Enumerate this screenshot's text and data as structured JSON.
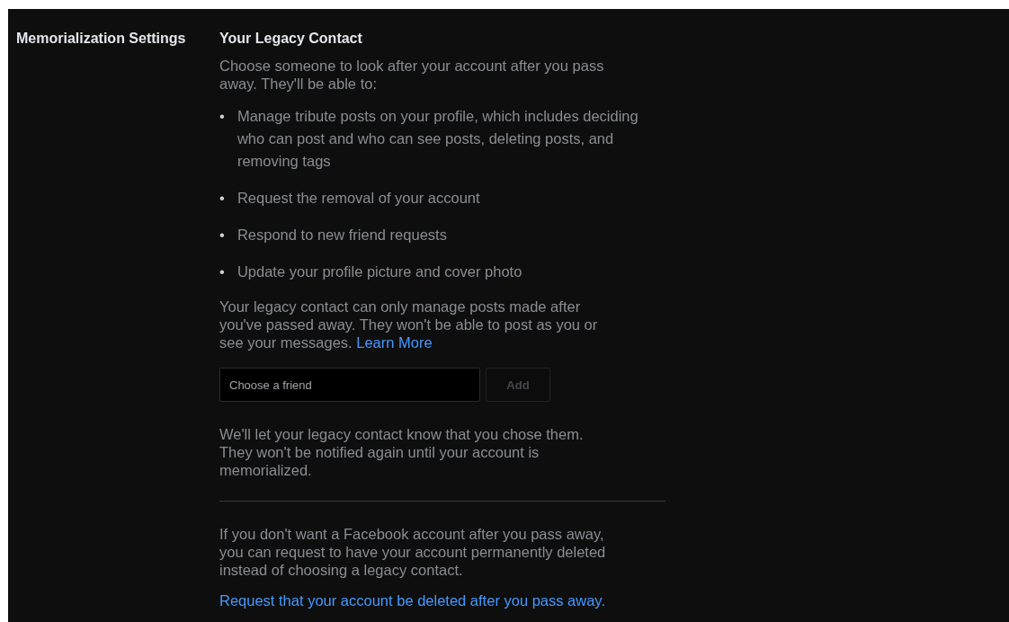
{
  "section_label": "Memorialization Settings",
  "heading": "Your Legacy Contact",
  "intro": "Choose someone to look after your account after you pass away. They'll be able to:",
  "abilities": [
    {
      "bullet": "•",
      "text": "Manage tribute posts on your profile, which includes deciding who can post and who can see posts, deleting posts, and removing tags"
    },
    {
      "bullet": "•",
      "text": "Request the removal of your account"
    },
    {
      "bullet": "•",
      "text": "Respond to new friend requests"
    },
    {
      "bullet": "•",
      "text": "Update your profile picture and cover photo"
    }
  ],
  "note": {
    "text": "Your legacy contact can only manage posts made after you've passed away. They won't be able to post as you or see your messages.",
    "link": "Learn More"
  },
  "friend_field": {
    "placeholder": "Choose a friend"
  },
  "add_button": {
    "label": "Add",
    "disabled": true
  },
  "confirmation": "We'll let your legacy contact know that you chose them. They won't be notified again until your account is memorialized.",
  "delete_info": "If you don't want a Facebook account after you pass away, you can request to have your account permanently deleted instead of choosing a legacy contact.",
  "delete_link": "Request that your account be deleted after you pass away."
}
